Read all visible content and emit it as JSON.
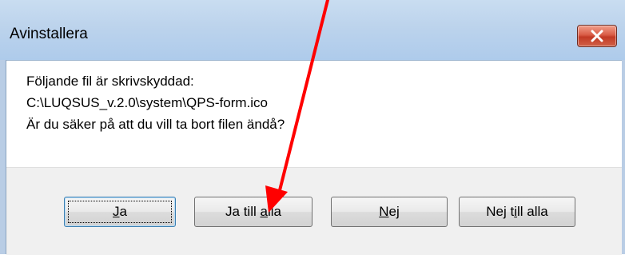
{
  "window": {
    "title": "Avinstallera",
    "close_icon": "close-icon"
  },
  "message": {
    "line1": "Följande fil är skrivskyddad:",
    "line2": "C:\\LUQSUS_v.2.0\\system\\QPS-form.ico",
    "line3": "Är du säker på att du vill ta bort filen ändå?"
  },
  "buttons": {
    "yes": {
      "pre": "",
      "mnemonic": "J",
      "post": "a"
    },
    "yes_all": {
      "pre": "Ja till ",
      "mnemonic": "a",
      "post": "lla"
    },
    "no": {
      "pre": "",
      "mnemonic": "N",
      "post": "ej"
    },
    "no_all": {
      "pre": "Nej t",
      "mnemonic": "i",
      "post": "ll alla"
    }
  },
  "colors": {
    "arrow": "#ff0000",
    "close_button": "#c94a35"
  }
}
